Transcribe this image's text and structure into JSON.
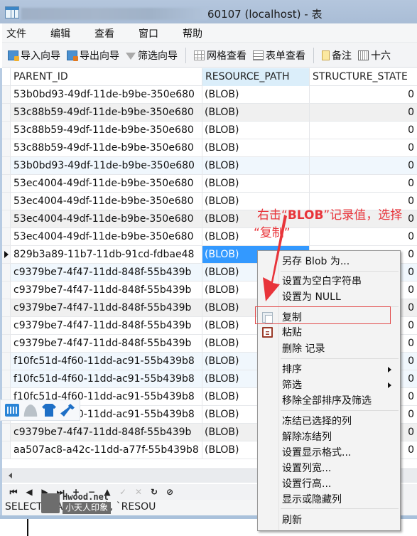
{
  "window": {
    "title": "60107 (localhost) - 表",
    "title_obscured": true,
    "icon": "table-app-icon"
  },
  "menu": {
    "items": [
      "文件",
      "编辑",
      "查看",
      "窗口",
      "帮助"
    ]
  },
  "toolbar": {
    "buttons": [
      {
        "label": "导入向导",
        "icon": "import-wizard-icon"
      },
      {
        "label": "导出向导",
        "icon": "export-wizard-icon"
      },
      {
        "label": "筛选向导",
        "icon": "filter-icon"
      },
      {
        "label": "网格查看",
        "icon": "grid-view-icon"
      },
      {
        "label": "表单查看",
        "icon": "form-view-icon"
      },
      {
        "label": "备注",
        "icon": "note-icon"
      },
      {
        "label": "十六",
        "icon": "hex-icon"
      }
    ]
  },
  "grid": {
    "columns": [
      "PARENT_ID",
      "RESOURCE_PATH",
      "STRUCTURE_STATE"
    ],
    "selected_column": "RESOURCE_PATH",
    "current_row_index": 9,
    "rows": [
      {
        "parent_id": "53b0bd93-49df-11de-b9be-350e680",
        "resource_path": "(BLOB)",
        "structure_state": "0"
      },
      {
        "parent_id": "53c88b59-49df-11de-b9be-350e680",
        "resource_path": "(BLOB)",
        "structure_state": "0"
      },
      {
        "parent_id": "53c88b59-49df-11de-b9be-350e680",
        "resource_path": "(BLOB)",
        "structure_state": "0"
      },
      {
        "parent_id": "53c88b59-49df-11de-b9be-350e680",
        "resource_path": "(BLOB)",
        "structure_state": "0"
      },
      {
        "parent_id": "53b0bd93-49df-11de-b9be-350e680",
        "resource_path": "(BLOB)",
        "structure_state": "0"
      },
      {
        "parent_id": "53ec4004-49df-11de-b9be-350e680",
        "resource_path": "(BLOB)",
        "structure_state": "0"
      },
      {
        "parent_id": "53ec4004-49df-11de-b9be-350e680",
        "resource_path": "(BLOB)",
        "structure_state": "0"
      },
      {
        "parent_id": "53ec4004-49df-11de-b9be-350e680",
        "resource_path": "(BLOB)",
        "structure_state": "0"
      },
      {
        "parent_id": "53ec4004-49df-11de-b9be-350e680",
        "resource_path": "(BLOB)",
        "structure_state": "0"
      },
      {
        "parent_id": "829b3a89-11b7-11db-91cd-fdbae48",
        "resource_path": "(BLOB)",
        "structure_state": "0"
      },
      {
        "parent_id": "c9379be7-4f47-11dd-848f-55b439b",
        "resource_path": "(BLOB)",
        "structure_state": "0"
      },
      {
        "parent_id": "c9379be7-4f47-11dd-848f-55b439b",
        "resource_path": "(BLOB)",
        "structure_state": "0"
      },
      {
        "parent_id": "c9379be7-4f47-11dd-848f-55b439b",
        "resource_path": "(BLOB)",
        "structure_state": "0"
      },
      {
        "parent_id": "c9379be7-4f47-11dd-848f-55b439b",
        "resource_path": "(BLOB)",
        "structure_state": "0"
      },
      {
        "parent_id": "c9379be7-4f47-11dd-848f-55b439b",
        "resource_path": "(BLOB)",
        "structure_state": "0"
      },
      {
        "parent_id": "f10fc51d-4f60-11dd-ac91-55b439b8",
        "resource_path": "(BLOB)",
        "structure_state": "0"
      },
      {
        "parent_id": "f10fc51d-4f60-11dd-ac91-55b439b8",
        "resource_path": "(BLOB)",
        "structure_state": "0"
      },
      {
        "parent_id": "f10fc51d-4f60-11dd-ac91-55b439b8",
        "resource_path": "(BLOB)",
        "structure_state": "0"
      },
      {
        "parent_id": "f10fc51d-4f60-11dd-ac91-55b439b8",
        "resource_path": "(BLOB)",
        "structure_state": "0"
      },
      {
        "parent_id": "c9379be7-4f47-11dd-848f-55b439b",
        "resource_path": "(BLOB)",
        "structure_state": "0"
      },
      {
        "parent_id": "aa507ac8-a42c-11dd-a77f-55b439b8",
        "resource_path": "(BLOB)",
        "structure_state": "0"
      }
    ]
  },
  "navigation": {
    "buttons": [
      {
        "name": "first-record",
        "glyph": "⏮",
        "enabled": true
      },
      {
        "name": "previous-record",
        "glyph": "◀",
        "enabled": true
      },
      {
        "name": "next-record",
        "glyph": "▶",
        "enabled": true
      },
      {
        "name": "last-record",
        "glyph": "⏭",
        "enabled": true
      },
      {
        "name": "add-record",
        "glyph": "+",
        "enabled": true
      },
      {
        "name": "delete-record",
        "glyph": "−",
        "enabled": true
      },
      {
        "name": "edit-record",
        "glyph": "▲",
        "enabled": true
      },
      {
        "name": "apply-changes",
        "glyph": "✓",
        "enabled": false
      },
      {
        "name": "discard-changes",
        "glyph": "✕",
        "enabled": false
      },
      {
        "name": "refresh",
        "glyph": "↻",
        "enabled": true
      },
      {
        "name": "stop",
        "glyph": "⊘",
        "enabled": true
      }
    ]
  },
  "status": {
    "sql": "SELECT `PARENT_ID`, `RESOU"
  },
  "watermark": {
    "top": "Hwood.net",
    "bottom": "小天人印象"
  },
  "ime_toolbar": {
    "icons": [
      "keyboard-icon",
      "user-icon",
      "skin-shirt-icon",
      "wrench-settings-icon"
    ]
  },
  "context_menu": {
    "items": [
      {
        "label": "另存 Blob 为...",
        "group": 1
      },
      {
        "label": "设置为空白字符串",
        "group": 2
      },
      {
        "label": "设置为 NULL",
        "group": 2
      },
      {
        "label": "复制",
        "group": 3,
        "icon": "copy-icon",
        "highlighted": true
      },
      {
        "label": "粘贴",
        "group": 3,
        "icon": "paste-icon"
      },
      {
        "label": "删除 记录",
        "group": 3
      },
      {
        "label": "排序",
        "group": 4,
        "submenu": true
      },
      {
        "label": "筛选",
        "group": 4,
        "submenu": true
      },
      {
        "label": "移除全部排序及筛选",
        "group": 4
      },
      {
        "label": "冻结已选择的列",
        "group": 5
      },
      {
        "label": "解除冻结列",
        "group": 5
      },
      {
        "label": "设置显示格式...",
        "group": 5
      },
      {
        "label": "设置列宽...",
        "group": 5
      },
      {
        "label": "设置行高...",
        "group": 5
      },
      {
        "label": "显示或隐藏列",
        "group": 5
      },
      {
        "label": "刷新",
        "group": 6
      }
    ]
  },
  "annotation": {
    "line1_prefix": "右击“",
    "line1_bold": "BLOB",
    "line1_suffix": "”记录值，选择",
    "line2": "“复制”",
    "color": "#e8343a"
  },
  "colors": {
    "selection": "#3399ff",
    "selected_header": "#dbeefa",
    "annotation_red": "#e8343a"
  }
}
